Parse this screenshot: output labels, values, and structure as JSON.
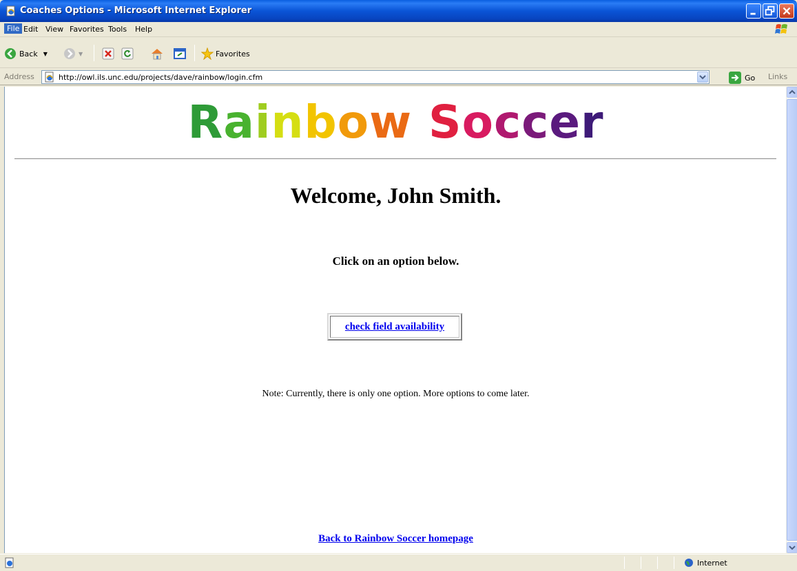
{
  "window": {
    "title": "Coaches Options - Microsoft Internet Explorer"
  },
  "menu": {
    "items": [
      "File",
      "Edit",
      "View",
      "Favorites",
      "Tools",
      "Help"
    ]
  },
  "toolbar": {
    "back_label": "Back",
    "favorites_label": "Favorites"
  },
  "address": {
    "label": "Address",
    "url": "http://owl.ils.unc.edu/projects/dave/rainbow/login.cfm",
    "go_label": "Go",
    "links_label": "Links"
  },
  "page": {
    "logo_letters": [
      {
        "ch": "R",
        "color": "#2e9b37"
      },
      {
        "ch": "a",
        "color": "#49b22f"
      },
      {
        "ch": "i",
        "color": "#9fcd1f"
      },
      {
        "ch": "n",
        "color": "#d5de12"
      },
      {
        "ch": "b",
        "color": "#f2c400"
      },
      {
        "ch": "o",
        "color": "#f19a0b"
      },
      {
        "ch": "w",
        "color": "#ea6a14"
      },
      {
        "ch": " ",
        "color": "#ffffff"
      },
      {
        "ch": "S",
        "color": "#e02040"
      },
      {
        "ch": "o",
        "color": "#d81b60"
      },
      {
        "ch": "c",
        "color": "#b0196f"
      },
      {
        "ch": "c",
        "color": "#7b1a7a"
      },
      {
        "ch": "e",
        "color": "#5a1a7e"
      },
      {
        "ch": "r",
        "color": "#3e1a78"
      }
    ],
    "welcome": "Welcome, John Smith.",
    "instruction": "Click on an option below.",
    "option_link": "check field availability",
    "note": "Note: Currently, there is only one option. More options to come later.",
    "back_link": "Back to Rainbow Soccer homepage"
  },
  "status": {
    "zone": "Internet"
  }
}
